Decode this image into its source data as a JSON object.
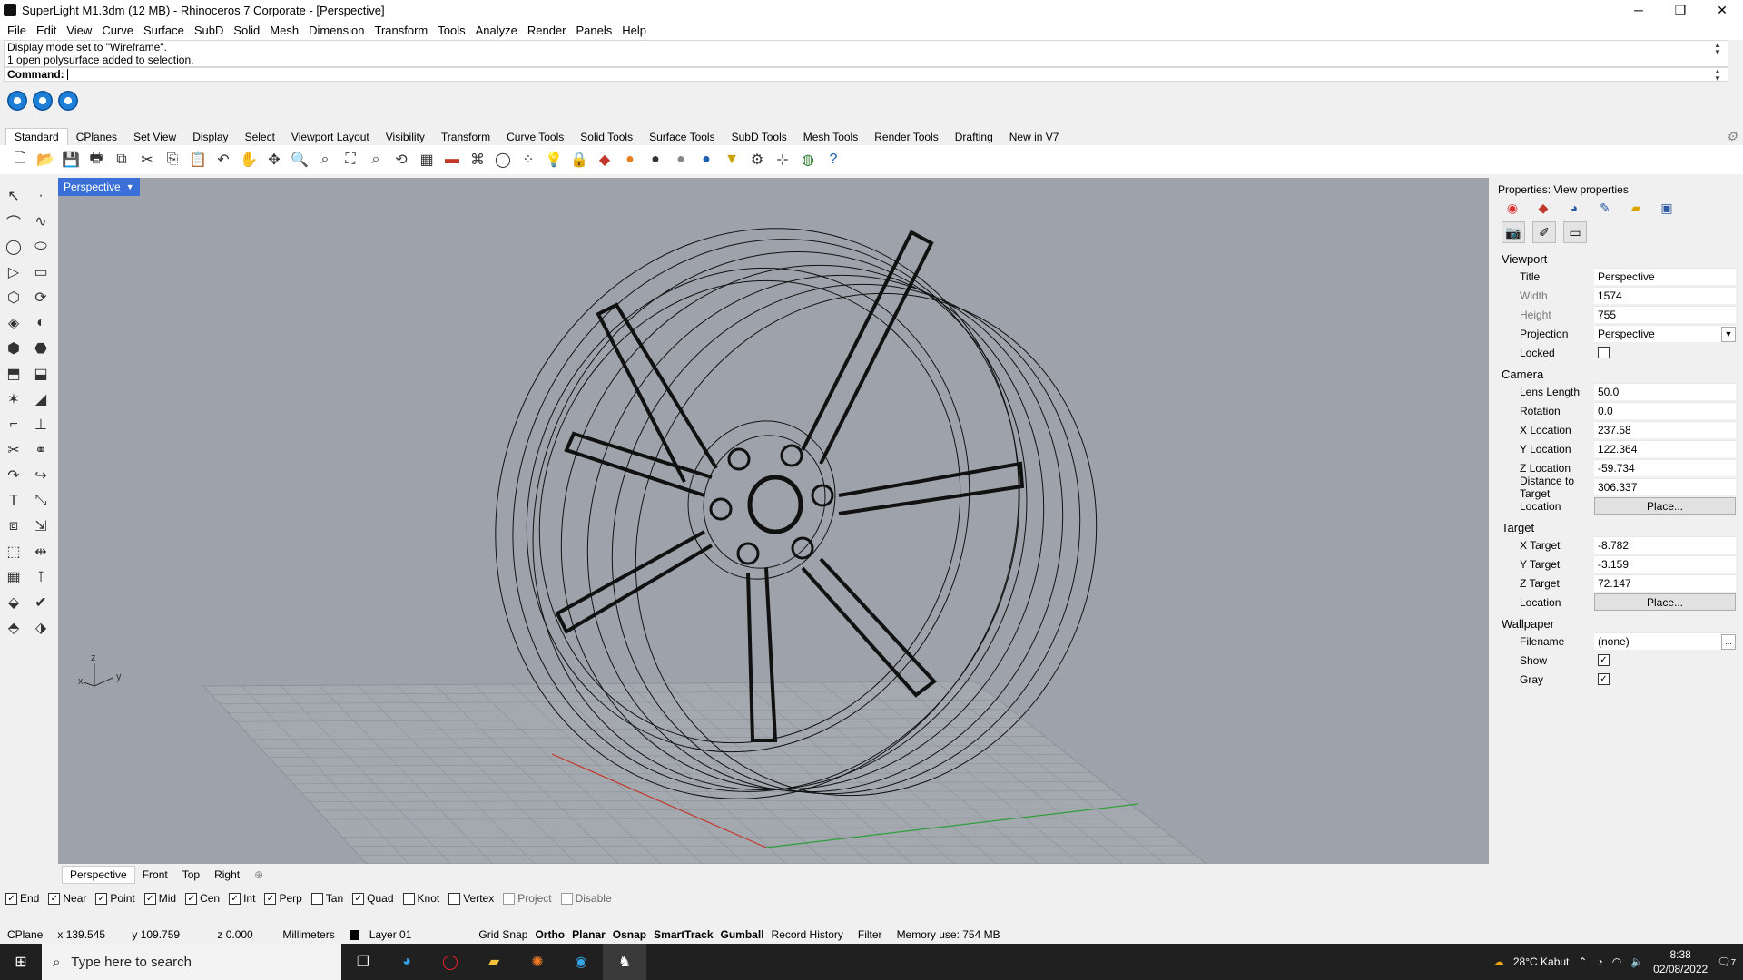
{
  "window": {
    "title": "SuperLight M1.3dm (12 MB) - Rhinoceros 7 Corporate - [Perspective]",
    "minimize": "─",
    "maximize": "❐",
    "close": "✕"
  },
  "menu": [
    "File",
    "Edit",
    "View",
    "Curve",
    "Surface",
    "SubD",
    "Solid",
    "Mesh",
    "Dimension",
    "Transform",
    "Tools",
    "Analyze",
    "Render",
    "Panels",
    "Help"
  ],
  "command": {
    "history": [
      "Display mode set to \"Wireframe\".",
      "1 open polysurface added to selection."
    ],
    "prompt": "Command:"
  },
  "toolbar_tabs": [
    "Standard",
    "CPlanes",
    "Set View",
    "Display",
    "Select",
    "Viewport Layout",
    "Visibility",
    "Transform",
    "Curve Tools",
    "Solid Tools",
    "Surface Tools",
    "SubD Tools",
    "Mesh Tools",
    "Render Tools",
    "Drafting",
    "New in V7"
  ],
  "toolbar_icons": [
    "new-icon",
    "open-icon",
    "save-icon",
    "print-icon",
    "import-icon",
    "cut-icon",
    "copy-icon",
    "paste-icon",
    "undo-icon",
    "pan-icon",
    "rotate-icon",
    "zoom-icon",
    "zoom-window-icon",
    "zoom-extents-icon",
    "zoom-selected-icon",
    "cplane-icon",
    "grid-icon",
    "car-icon",
    "mesh-icon",
    "circle-icon",
    "points-icon",
    "light-icon",
    "lock-icon",
    "layer-icon",
    "render-sphere-icon",
    "shade-sphere-icon",
    "ghost-sphere-icon",
    "material-sphere-icon",
    "filter-icon",
    "options-icon",
    "snap-icon",
    "globe-icon",
    "help-icon"
  ],
  "viewport": {
    "name": "Perspective",
    "tabs": [
      "Perspective",
      "Front",
      "Top",
      "Right"
    ],
    "axis": {
      "z": "z",
      "x": "x",
      "y": "y"
    }
  },
  "properties": {
    "title": "Properties: View properties",
    "sections": {
      "viewport": "Viewport",
      "camera": "Camera",
      "target": "Target",
      "wallpaper": "Wallpaper"
    },
    "viewport_rows": [
      {
        "label": "Title",
        "value": "Perspective"
      },
      {
        "label": "Width",
        "value": "1574"
      },
      {
        "label": "Height",
        "value": "755"
      },
      {
        "label": "Projection",
        "value": "Perspective"
      }
    ],
    "locked_label": "Locked",
    "camera_rows": [
      {
        "label": "Lens Length",
        "value": "50.0"
      },
      {
        "label": "Rotation",
        "value": "0.0"
      },
      {
        "label": "X Location",
        "value": "237.58"
      },
      {
        "label": "Y Location",
        "value": "122.364"
      },
      {
        "label": "Z Location",
        "value": "-59.734"
      },
      {
        "label": "Distance to Target",
        "value": "306.337"
      }
    ],
    "camera_location_label": "Location",
    "place_button": "Place...",
    "target_rows": [
      {
        "label": "X Target",
        "value": "-8.782"
      },
      {
        "label": "Y Target",
        "value": "-3.159"
      },
      {
        "label": "Z Target",
        "value": "72.147"
      }
    ],
    "target_location_label": "Location",
    "wallpaper_filename_label": "Filename",
    "wallpaper_filename": "(none)",
    "wallpaper_browse": "...",
    "show_label": "Show",
    "gray_label": "Gray"
  },
  "osnap": [
    {
      "label": "End",
      "checked": true
    },
    {
      "label": "Near",
      "checked": true
    },
    {
      "label": "Point",
      "checked": true
    },
    {
      "label": "Mid",
      "checked": true
    },
    {
      "label": "Cen",
      "checked": true
    },
    {
      "label": "Int",
      "checked": true
    },
    {
      "label": "Perp",
      "checked": true
    },
    {
      "label": "Tan",
      "checked": false
    },
    {
      "label": "Quad",
      "checked": true
    },
    {
      "label": "Knot",
      "checked": false
    },
    {
      "label": "Vertex",
      "checked": false
    },
    {
      "label": "Project",
      "checked": false
    },
    {
      "label": "Disable",
      "checked": false
    }
  ],
  "status": {
    "cplane": "CPlane",
    "x": "x 139.545",
    "y": "y 109.759",
    "z": "z 0.000",
    "units": "Millimeters",
    "layer": "Layer 01",
    "grid_snap": "Grid Snap",
    "ortho": "Ortho",
    "planar": "Planar",
    "osnap": "Osnap",
    "smarttrack": "SmartTrack",
    "gumball": "Gumball",
    "record_history": "Record History",
    "filter": "Filter",
    "memory": "Memory use: 754 MB"
  },
  "taskbar": {
    "search_placeholder": "Type here to search",
    "weather": "28°C  Kabut",
    "time": "8:38",
    "date": "02/08/2022",
    "notifications": "7"
  },
  "colors": {
    "viewport_bg": "#9ea3ab",
    "viewport_label": "#3a6fd8",
    "x_axis": "#c0392b",
    "y_axis": "#2e9e3a"
  }
}
